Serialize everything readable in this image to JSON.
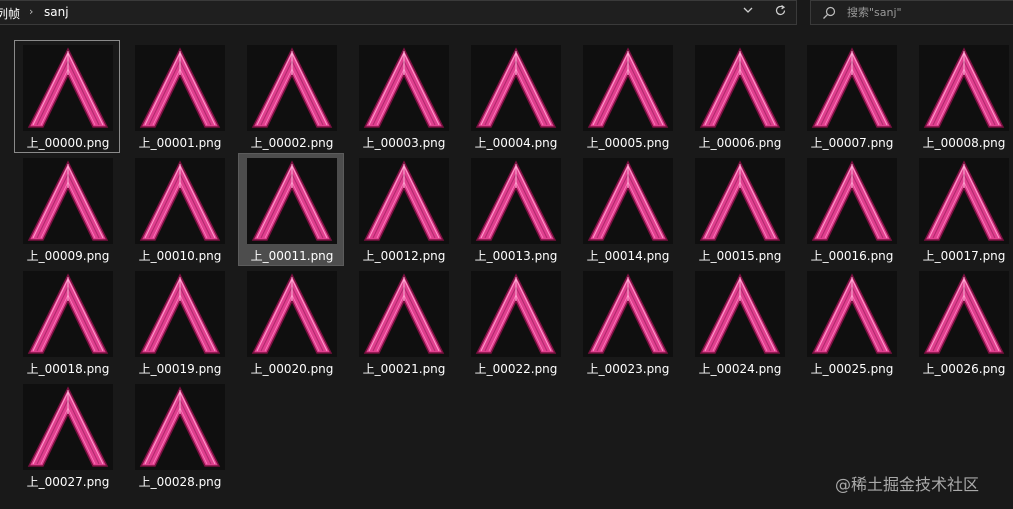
{
  "address_bar": {
    "breadcrumbs": [
      "列帧",
      "sanj"
    ],
    "separator": "›",
    "dropdown_icon": "chevron-down-icon",
    "refresh_icon": "refresh-icon"
  },
  "search": {
    "placeholder": "搜索\"sanj\"",
    "icon": "search-icon"
  },
  "files": [
    {
      "name": "上_00000.png"
    },
    {
      "name": "上_00001.png"
    },
    {
      "name": "上_00002.png"
    },
    {
      "name": "上_00003.png"
    },
    {
      "name": "上_00004.png"
    },
    {
      "name": "上_00005.png"
    },
    {
      "name": "上_00006.png"
    },
    {
      "name": "上_00007.png"
    },
    {
      "name": "上_00008.png"
    },
    {
      "name": "上_00009.png"
    },
    {
      "name": "上_00010.png"
    },
    {
      "name": "上_00011.png"
    },
    {
      "name": "上_00012.png"
    },
    {
      "name": "上_00013.png"
    },
    {
      "name": "上_00014.png"
    },
    {
      "name": "上_00015.png"
    },
    {
      "name": "上_00016.png"
    },
    {
      "name": "上_00017.png"
    },
    {
      "name": "上_00018.png"
    },
    {
      "name": "上_00019.png"
    },
    {
      "name": "上_00020.png"
    },
    {
      "name": "上_00021.png"
    },
    {
      "name": "上_00022.png"
    },
    {
      "name": "上_00023.png"
    },
    {
      "name": "上_00024.png"
    },
    {
      "name": "上_00025.png"
    },
    {
      "name": "上_00026.png"
    },
    {
      "name": "上_00027.png"
    },
    {
      "name": "上_00028.png"
    }
  ],
  "focused_file": "上_00000.png",
  "selected_file": "上_00011.png",
  "watermark": "@稀土掘金技术社区",
  "colors": {
    "background": "#191919",
    "thumb_pink": "#e0408f",
    "thumb_light": "#ff9ccc",
    "selection": "#4d4d4d"
  }
}
